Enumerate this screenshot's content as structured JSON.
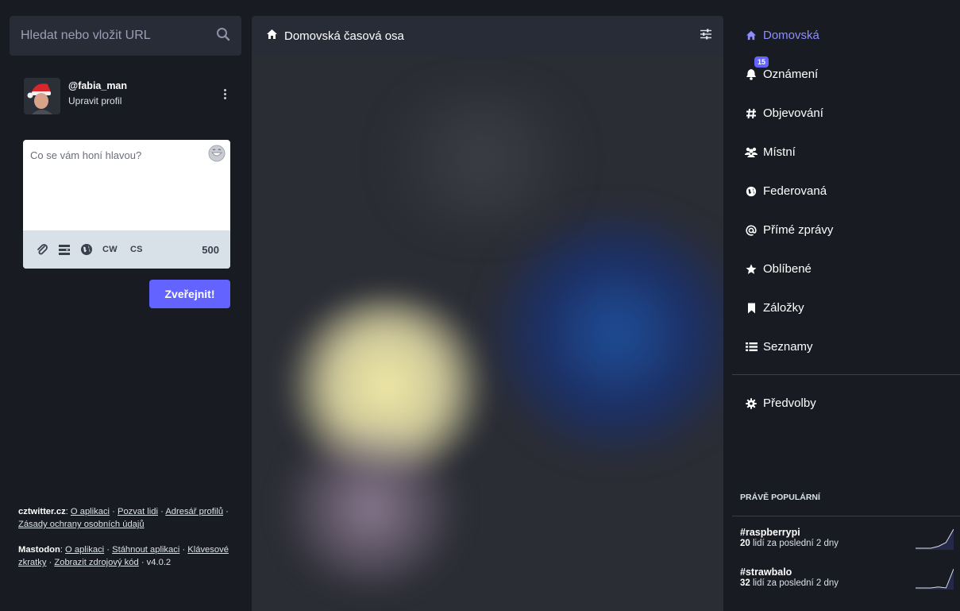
{
  "search": {
    "placeholder": "Hledat nebo vložit URL"
  },
  "profile": {
    "handle": "@fabia_man",
    "edit": "Upravit profil"
  },
  "compose": {
    "placeholder": "Co se vám honí hlavou?",
    "cw": "CW",
    "language": "CS",
    "char_count": "500",
    "publish": "Zveřejnit!"
  },
  "footer": {
    "server": "cztwitter.cz",
    "about": "O aplikaci",
    "invite": "Pozvat lidi",
    "directory": "Adresář profilů",
    "privacy": "Zásady ochrany osobních údajů",
    "mastodon": "Mastodon",
    "m_about": "O aplikaci",
    "apps": "Stáhnout aplikaci",
    "shortcuts": "Klávesové zkratky",
    "source": "Zobrazit zdrojový kód",
    "version": "v4.0.2"
  },
  "column": {
    "title": "Domovská časová osa"
  },
  "nav": {
    "items": [
      {
        "label": "Domovská",
        "icon": "home-icon"
      },
      {
        "label": "Oznámení",
        "icon": "bell-icon",
        "badge": "15"
      },
      {
        "label": "Objevování",
        "icon": "hashtag-icon"
      },
      {
        "label": "Místní",
        "icon": "users-icon"
      },
      {
        "label": "Federovaná",
        "icon": "globe-icon"
      },
      {
        "label": "Přímé zprávy",
        "icon": "at-icon"
      },
      {
        "label": "Oblíbené",
        "icon": "star-icon"
      },
      {
        "label": "Záložky",
        "icon": "bookmark-icon"
      },
      {
        "label": "Seznamy",
        "icon": "list-icon"
      }
    ],
    "preferences": "Předvolby"
  },
  "trending": {
    "title": "PRÁVĚ POPULÁRNÍ",
    "tags": [
      {
        "tag": "#raspberrypi",
        "count": "20",
        "text": " lidí za poslední 2 dny",
        "sparkline": [
          0,
          0,
          0,
          1,
          3,
          10
        ]
      },
      {
        "tag": "#strawbalo",
        "count": "32",
        "text": " lidí za poslední 2 dny",
        "sparkline": [
          0,
          0,
          0,
          1,
          0,
          20
        ]
      }
    ]
  },
  "colors": {
    "accent": "#6364ff",
    "active_nav": "#8c8dff",
    "background": "#191b22",
    "panel": "#282c37"
  }
}
